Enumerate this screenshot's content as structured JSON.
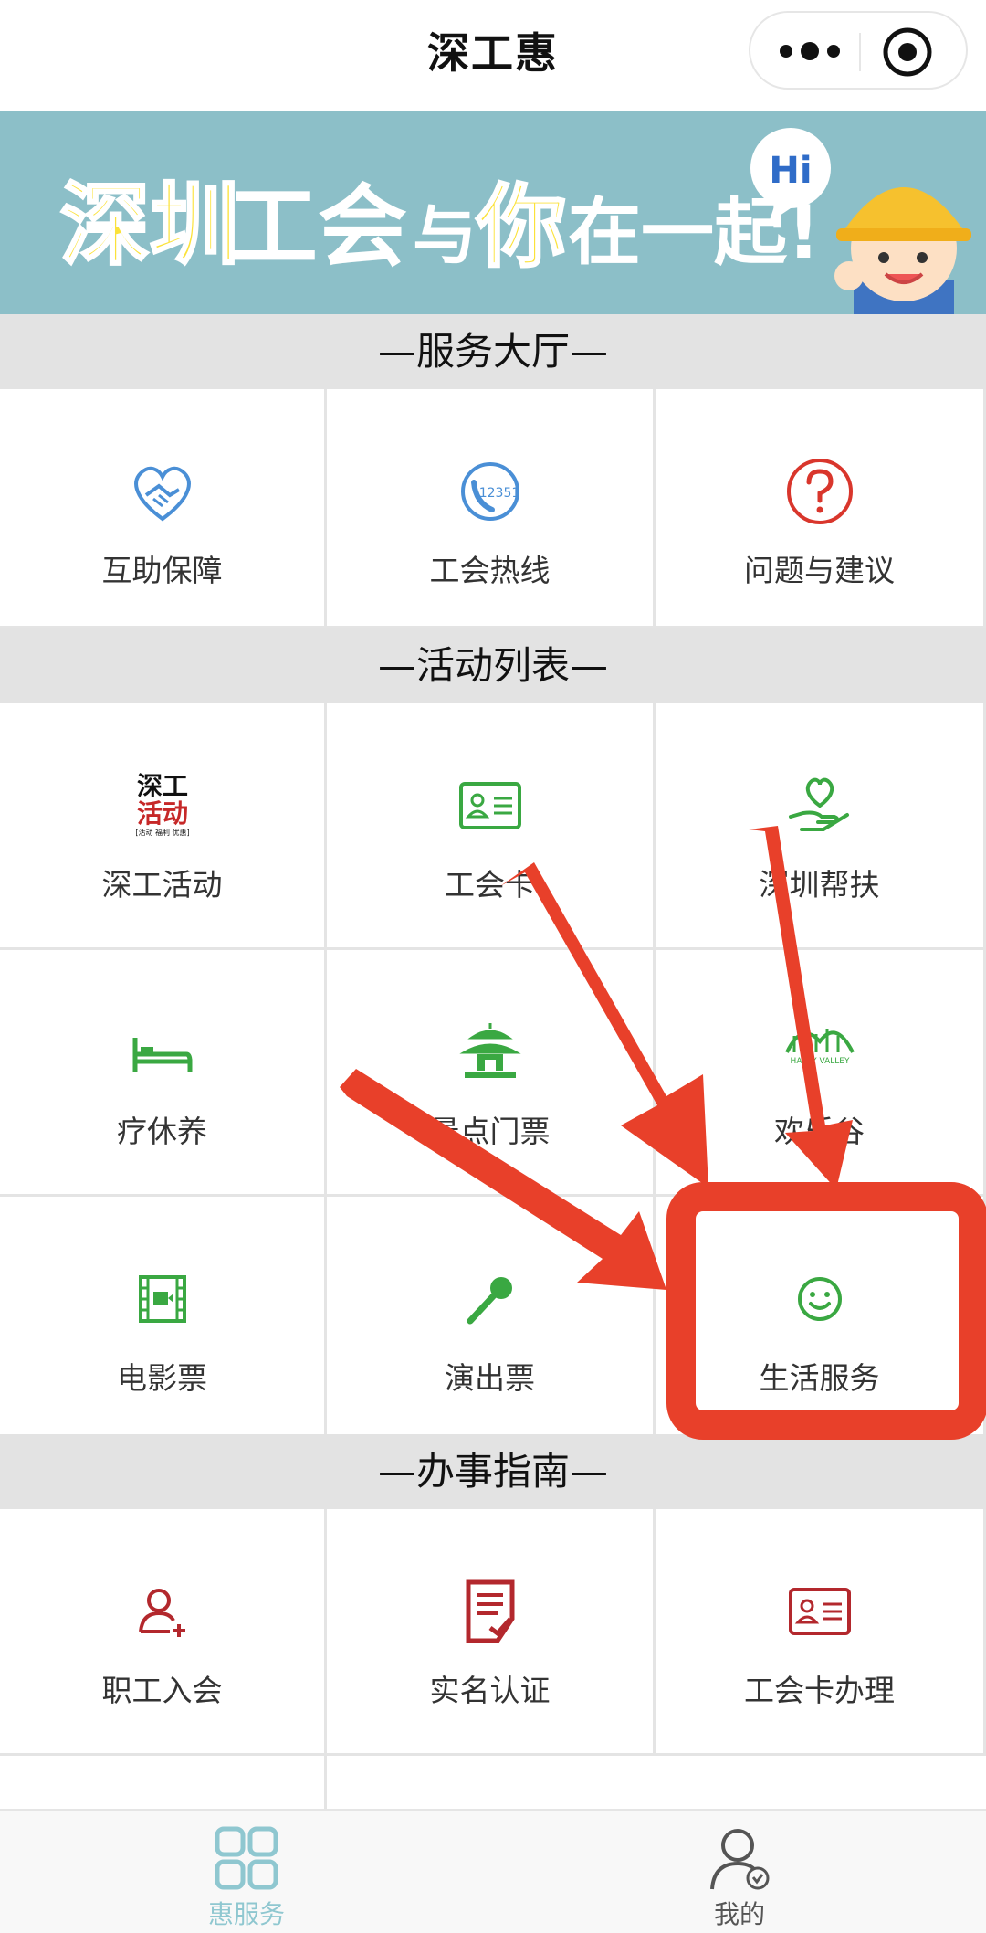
{
  "header": {
    "title": "深工惠"
  },
  "banner": {
    "text_part1": "深圳",
    "text_part2": "工会",
    "text_part3": "与",
    "text_part4": "你",
    "text_part5": "在一起!",
    "bubble": "Hi"
  },
  "sections": [
    {
      "title": "—服务大厅—"
    },
    {
      "title": "—活动列表—"
    },
    {
      "title": "—办事指南—"
    }
  ],
  "service_hall": [
    {
      "label": "互助保障",
      "icon": "handshake-heart-icon"
    },
    {
      "label": "工会热线",
      "icon": "phone-12351-icon"
    },
    {
      "label": "问题与建议",
      "icon": "question-circle-icon"
    }
  ],
  "activities": [
    {
      "label": "深工活动",
      "icon": "shengong-activity-logo",
      "logo_top": "深工",
      "logo_mid": "活动",
      "logo_bottom": "[活动 福利 优惠]"
    },
    {
      "label": "工会卡",
      "icon": "id-card-icon"
    },
    {
      "label": "深圳帮扶",
      "icon": "heart-hand-icon"
    },
    {
      "label": "疗休养",
      "icon": "bed-icon"
    },
    {
      "label": "景点门票",
      "icon": "pavilion-icon"
    },
    {
      "label": "欢乐谷",
      "icon": "happy-valley-logo",
      "logo_text": "HAPPY VALLEY"
    },
    {
      "label": "电影票",
      "icon": "film-icon"
    },
    {
      "label": "演出票",
      "icon": "microphone-icon"
    },
    {
      "label": "生活服务",
      "icon": "smile-icon"
    }
  ],
  "guide": [
    {
      "label": "职工入会",
      "icon": "add-user-icon"
    },
    {
      "label": "实名认证",
      "icon": "document-check-icon"
    },
    {
      "label": "工会卡办理",
      "icon": "id-card-icon"
    }
  ],
  "tabs": [
    {
      "label": "惠服务",
      "icon": "grid-icon",
      "active": true,
      "color": "#8fc7d0"
    },
    {
      "label": "我的",
      "icon": "user-check-icon",
      "active": false,
      "color": "#555555"
    }
  ],
  "colors": {
    "banner_bg": "#8cbfc8",
    "green": "#3aa842",
    "dark_red": "#b3282d",
    "blue": "#4a8fd6",
    "annotation_red": "#e8402a"
  }
}
